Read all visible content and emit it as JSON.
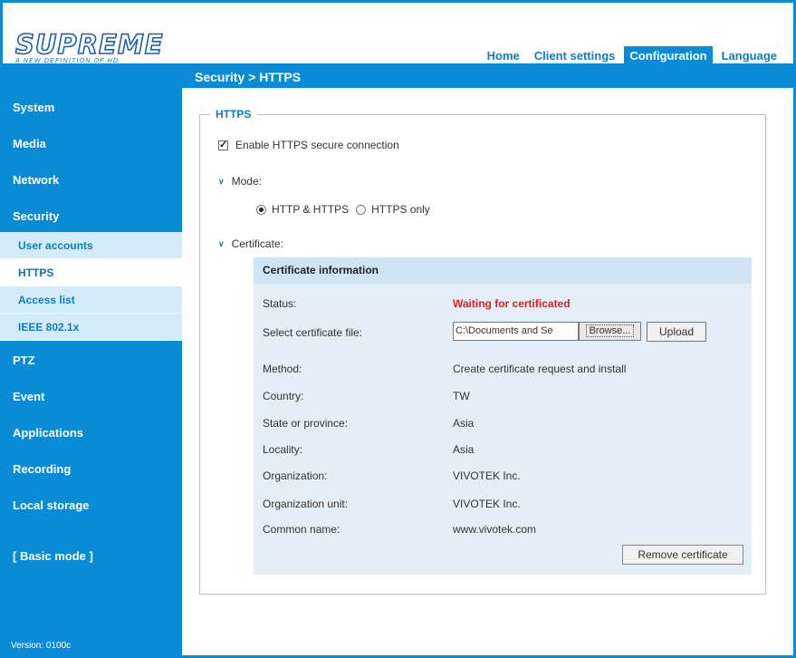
{
  "logo": {
    "word": "SUPREME",
    "tagline": "A NEW DEFINITION OF HD"
  },
  "topnav": [
    "Home",
    "Client settings",
    "Configuration",
    "Language"
  ],
  "breadcrumb": "Security > HTTPS",
  "sidebar": {
    "items": [
      "System",
      "Media",
      "Network",
      "Security"
    ],
    "security_sub": [
      "User accounts",
      "HTTPS",
      "Access list",
      "IEEE 802.1x"
    ],
    "items_after": [
      "PTZ",
      "Event",
      "Applications",
      "Recording",
      "Local storage"
    ],
    "basic_mode": "[ Basic mode ]",
    "version": "Version: 0100c"
  },
  "https": {
    "legend": "HTTPS",
    "enable_label": "Enable HTTPS secure connection",
    "mode_label": "Mode:",
    "mode_options": [
      "HTTP & HTTPS",
      "HTTPS only"
    ],
    "certificate_label": "Certificate:"
  },
  "cert": {
    "header": "Certificate information",
    "status_label": "Status:",
    "status_value": "Waiting for certificated",
    "select_label": "Select certificate file:",
    "file_value": "C:\\Documents and Se",
    "browse": "Browse...",
    "upload": "Upload",
    "rows": [
      {
        "label": "Method:",
        "value": "Create certificate request and install"
      },
      {
        "label": "Country:",
        "value": "TW"
      },
      {
        "label": "State or province:",
        "value": "Asia"
      },
      {
        "label": "Locality:",
        "value": "Asia"
      },
      {
        "label": "Organization:",
        "value": "VIVOTEK Inc."
      },
      {
        "label": "Organization unit:",
        "value": "VIVOTEK Inc."
      },
      {
        "label": "Common name:",
        "value": "www.vivotek.com"
      }
    ],
    "remove": "Remove certificate"
  }
}
